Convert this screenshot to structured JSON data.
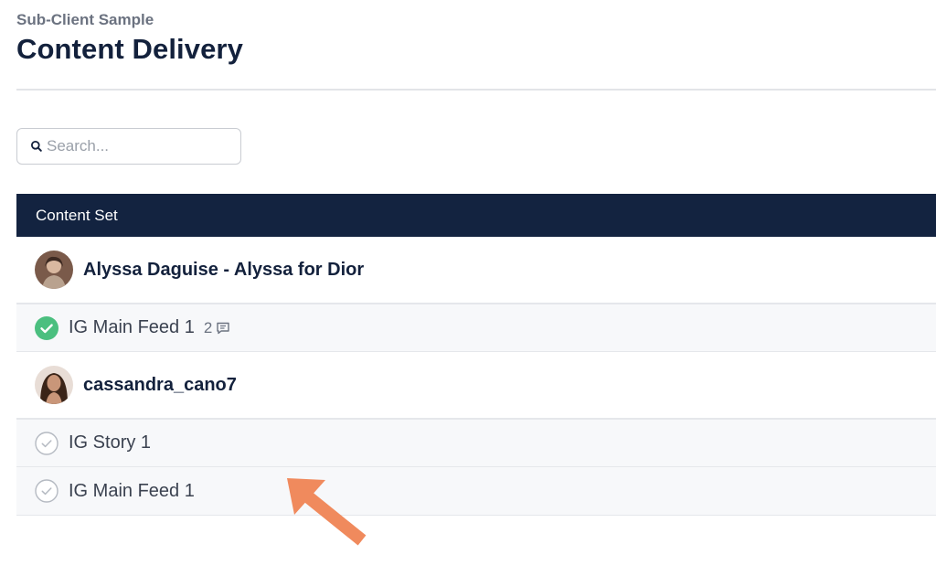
{
  "header": {
    "subtitle": "Sub-Client Sample",
    "title": "Content Delivery"
  },
  "search": {
    "placeholder": "Search...",
    "value": "",
    "icon": "search-icon"
  },
  "table": {
    "column_header": "Content Set",
    "groups": [
      {
        "name": "Alyssa Daguise - Alyssa for Dior",
        "items": [
          {
            "label": "IG Main Feed 1",
            "status": "approved",
            "comment_count": "2"
          }
        ]
      },
      {
        "name": "cassandra_cano7",
        "items": [
          {
            "label": "IG Story 1",
            "status": "pending"
          },
          {
            "label": "IG Main Feed 1",
            "status": "pending"
          }
        ]
      }
    ]
  },
  "colors": {
    "navy": "#132340",
    "approved_green": "#4bbf7f",
    "pending_gray": "#b5bac2",
    "annotation_arrow": "#f08a5d"
  }
}
